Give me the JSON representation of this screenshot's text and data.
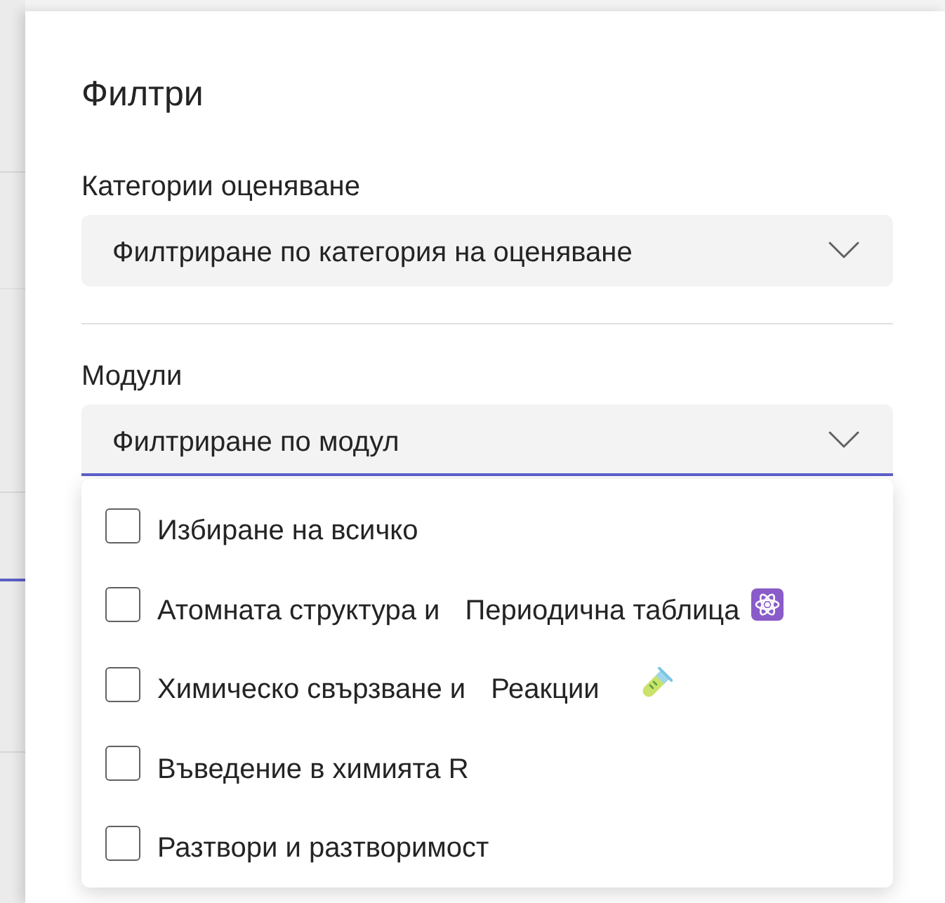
{
  "panel": {
    "title": "Филтри"
  },
  "filters": [
    {
      "label": "Категории оценяване",
      "placeholder": "Филтриране по категория на оценяване",
      "expanded": false
    },
    {
      "label": "Модули",
      "placeholder": "Филтриране по модул",
      "expanded": true,
      "options": [
        {
          "kind": "plain",
          "segments": [
            "Избиране на всичко"
          ],
          "checked": false
        },
        {
          "kind": "atom",
          "segments": [
            "Атомната структура и",
            "Периодична таблица"
          ],
          "checked": false
        },
        {
          "kind": "tube",
          "segments": [
            "Химическо свързване и",
            "Реакции"
          ],
          "checked": false
        },
        {
          "kind": "plain",
          "segments": [
            "Въведение в химията R"
          ],
          "checked": false
        },
        {
          "kind": "plain",
          "segments": [
            "Разтвори и разтворимост"
          ],
          "checked": false
        }
      ]
    }
  ]
}
